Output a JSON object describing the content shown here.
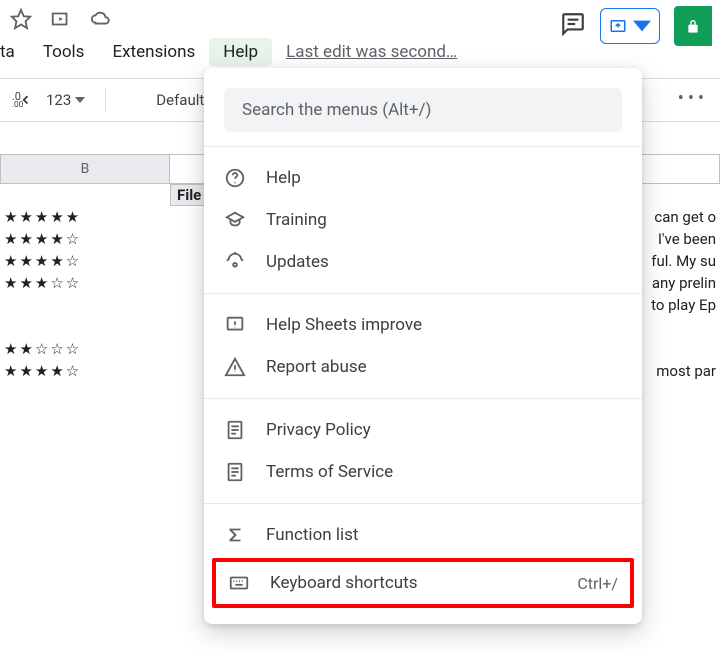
{
  "top_icons": {
    "star": "star",
    "move": "move",
    "cloud": "cloud"
  },
  "menubar": {
    "items": [
      "ta",
      "Tools",
      "Extensions",
      "Help"
    ],
    "active_index": 3,
    "last_edit": "Last edit was second…"
  },
  "toolbar": {
    "decimal_tip": "decrease-decimals",
    "number_format": "123",
    "font": "Default (Ari…"
  },
  "sheet": {
    "col_b_label": "B",
    "file_header": "File",
    "rows_left": [
      "★★★★★",
      "★★★★☆",
      "★★★★☆",
      "★★★☆☆",
      "",
      "★★☆☆☆",
      "★★★★☆"
    ],
    "rows_right": [
      "can get o",
      "I've been",
      "ful. My su",
      "any prelin",
      "to play Ep",
      "",
      "most par"
    ]
  },
  "menu": {
    "search_placeholder": "Search the menus (Alt+/)",
    "group1": [
      {
        "label": "Help",
        "icon": "help"
      },
      {
        "label": "Training",
        "icon": "training"
      },
      {
        "label": "Updates",
        "icon": "updates"
      }
    ],
    "group2": [
      {
        "label": "Help Sheets improve",
        "icon": "feedback"
      },
      {
        "label": "Report abuse",
        "icon": "warning"
      }
    ],
    "group3": [
      {
        "label": "Privacy Policy",
        "icon": "doc"
      },
      {
        "label": "Terms of Service",
        "icon": "doc"
      }
    ],
    "group4_first": {
      "label": "Function list",
      "icon": "sigma"
    },
    "group4_highlight": {
      "label": "Keyboard shortcuts",
      "icon": "keyboard",
      "shortcut": "Ctrl+/"
    }
  }
}
